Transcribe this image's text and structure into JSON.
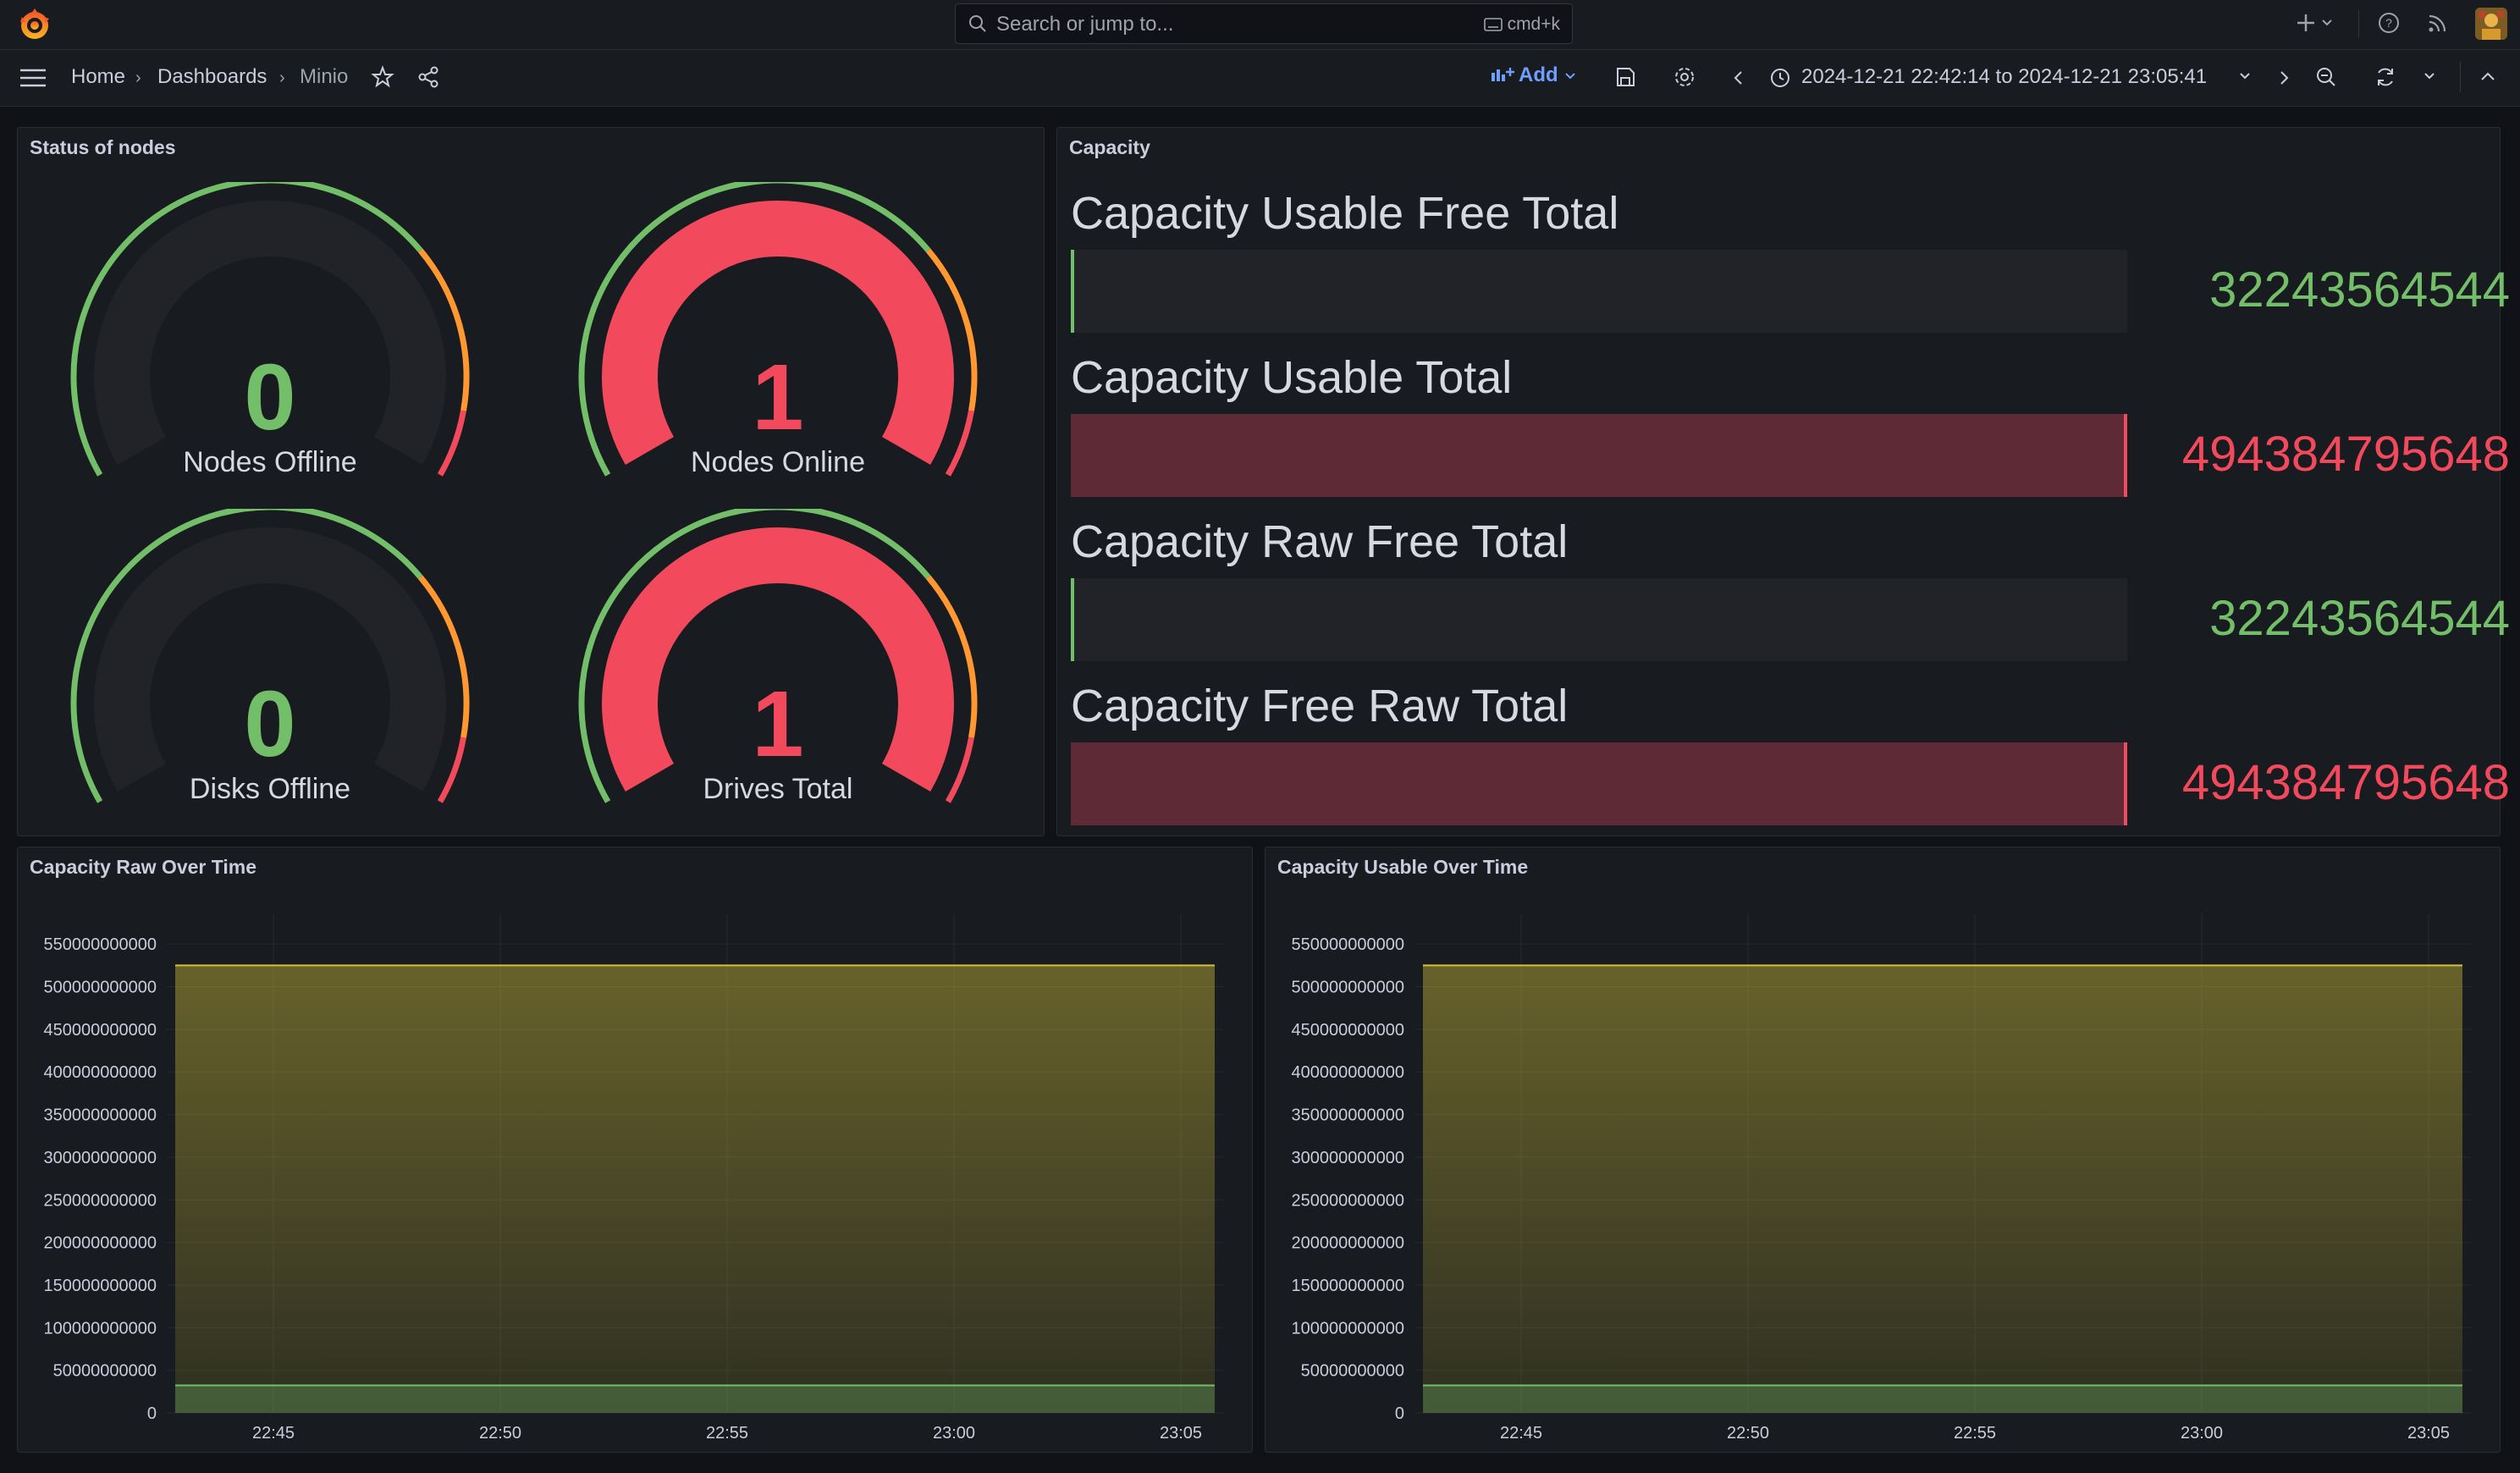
{
  "app": {
    "search_placeholder": "Search or jump to...",
    "search_shortcut": "cmd+k"
  },
  "breadcrumbs": [
    "Home",
    "Dashboards",
    "Minio"
  ],
  "toolbar": {
    "add_label": "Add",
    "time_range": "2024-12-21 22:42:14 to 2024-12-21 23:05:41"
  },
  "colors": {
    "green": "#73bf69",
    "red": "#f2495c",
    "orange": "#ff9830",
    "dark_red_fill": "#5e2a35",
    "series_yellow": "#d4c33a",
    "series_green": "#73bf69"
  },
  "status_panel": {
    "title": "Status of nodes",
    "gauges": [
      {
        "label": "Nodes Offline",
        "value": "0",
        "color": "#73bf69",
        "fill": 0
      },
      {
        "label": "Nodes Online",
        "value": "1",
        "color": "#f2495c",
        "fill": 1
      },
      {
        "label": "Disks Offline",
        "value": "0",
        "color": "#73bf69",
        "fill": 0
      },
      {
        "label": "Drives Total",
        "value": "1",
        "color": "#f2495c",
        "fill": 1
      }
    ]
  },
  "capacity_panel": {
    "title": "Capacity",
    "rows": [
      {
        "title": "Capacity Usable Free Total",
        "value": "32243564544",
        "color": "#73bf69",
        "fill": 0
      },
      {
        "title": "Capacity Usable Total",
        "value": "494384795648",
        "color": "#f2495c",
        "fill": 1
      },
      {
        "title": "Capacity Raw Free Total",
        "value": "32243564544",
        "color": "#73bf69",
        "fill": 0
      },
      {
        "title": "Capacity Free Raw Total",
        "value": "494384795648",
        "color": "#f2495c",
        "fill": 1
      }
    ]
  },
  "chart_data": [
    {
      "type": "area",
      "title": "Capacity Raw Over Time",
      "x_ticks": [
        "22:45",
        "22:50",
        "22:55",
        "23:00",
        "23:05"
      ],
      "y_ticks": [
        "550000000000",
        "500000000000",
        "450000000000",
        "400000000000",
        "350000000000",
        "300000000000",
        "250000000000",
        "200000000000",
        "150000000000",
        "100000000000",
        "50000000000",
        "0"
      ],
      "ylim": [
        0,
        580000000000
      ],
      "series": [
        {
          "values": [
            525000000000,
            525000000000
          ],
          "color": "#d4c33a"
        },
        {
          "values": [
            32243564544,
            32243564544
          ],
          "color": "#73bf69"
        }
      ]
    },
    {
      "type": "area",
      "title": "Capacity Usable Over Time",
      "x_ticks": [
        "22:45",
        "22:50",
        "22:55",
        "23:00",
        "23:05"
      ],
      "y_ticks": [
        "550000000000",
        "500000000000",
        "450000000000",
        "400000000000",
        "350000000000",
        "300000000000",
        "250000000000",
        "200000000000",
        "150000000000",
        "100000000000",
        "50000000000",
        "0"
      ],
      "ylim": [
        0,
        580000000000
      ],
      "series": [
        {
          "values": [
            525000000000,
            525000000000
          ],
          "color": "#d4c33a"
        },
        {
          "values": [
            32243564544,
            32243564544
          ],
          "color": "#73bf69"
        }
      ]
    }
  ]
}
